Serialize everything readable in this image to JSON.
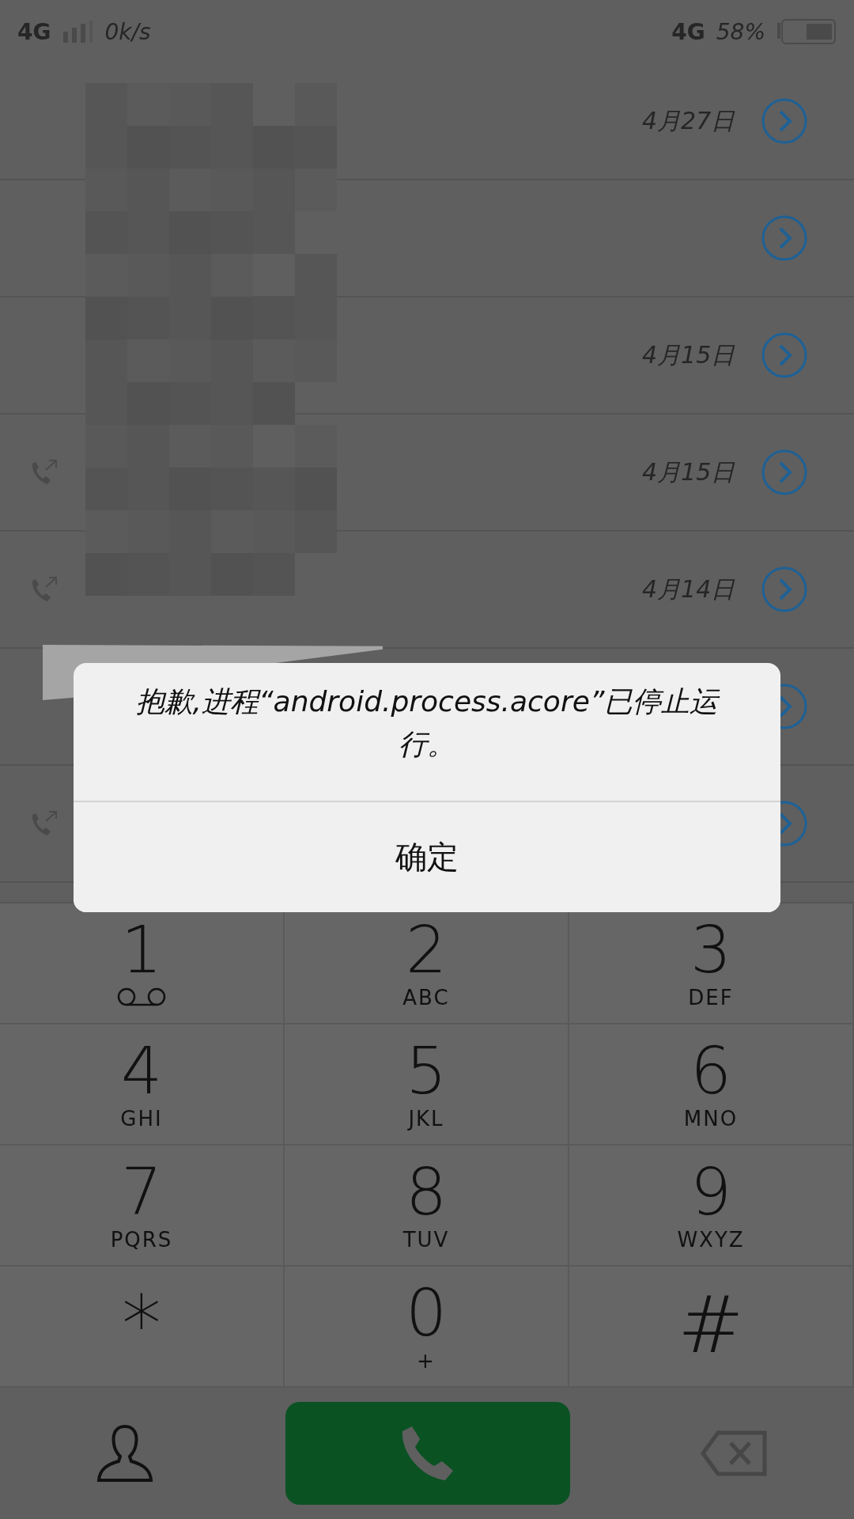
{
  "status_bar": {
    "network_left": "4G",
    "speed": "0k/s",
    "network_right": "4G",
    "battery": "58%"
  },
  "call_log": [
    {
      "date": "4月27日",
      "outgoing": false
    },
    {
      "outgoing": false
    },
    {
      "date": "4月15日",
      "outgoing": false
    },
    {
      "date": "4月15日",
      "outgoing": true
    },
    {
      "date": "4月14日",
      "outgoing": true
    },
    {
      "outgoing": false
    },
    {
      "outgoing": true
    }
  ],
  "dialog": {
    "message": "抱歉,进程“android.process.acore”已停止运行。",
    "button": "确定"
  },
  "keypad": [
    {
      "digit": "1",
      "kind": "voicemail"
    },
    {
      "digit": "2",
      "letters": "ABC",
      "kind": "letters"
    },
    {
      "digit": "3",
      "letters": "DEF",
      "kind": "letters"
    },
    {
      "digit": "4",
      "letters": "GHI",
      "kind": "letters"
    },
    {
      "digit": "5",
      "letters": "JKL",
      "kind": "letters"
    },
    {
      "digit": "6",
      "letters": "MNO",
      "kind": "letters"
    },
    {
      "digit": "7",
      "letters": "PQRS",
      "kind": "letters"
    },
    {
      "digit": "8",
      "letters": "TUV",
      "kind": "letters"
    },
    {
      "digit": "9",
      "letters": "WXYZ",
      "kind": "letters"
    },
    {
      "digit": "*",
      "kind": "symbol"
    },
    {
      "digit": "0",
      "letters": "+",
      "kind": "letters"
    },
    {
      "digit": "#",
      "kind": "symbol"
    }
  ]
}
